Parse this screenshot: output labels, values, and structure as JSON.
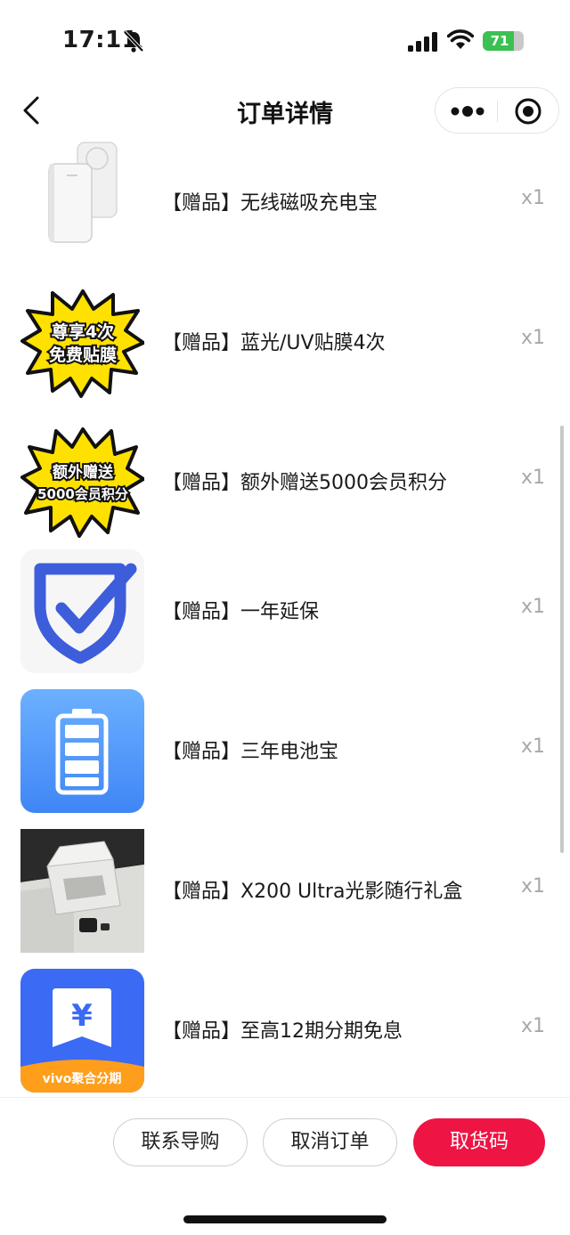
{
  "status_bar": {
    "time": "17:11",
    "battery_level": "71",
    "icons": [
      "bell-slash-icon",
      "signal-icon",
      "wifi-icon",
      "battery-icon"
    ]
  },
  "nav": {
    "title": "订单详情",
    "icons": [
      "chevron-left-icon",
      "more-dots-icon",
      "target-circle-icon"
    ]
  },
  "gifts": [
    {
      "name": "【赠品】无线磁吸充电宝",
      "qty": "x1",
      "thumb": "power-bank-image"
    },
    {
      "name": "【赠品】蓝光/UV贴膜4次",
      "qty": "x1",
      "thumb": "starburst-badge",
      "badge_lines": [
        "尊享4次",
        "免费贴膜"
      ]
    },
    {
      "name": "【赠品】额外赠送5000会员积分",
      "qty": "x1",
      "thumb": "starburst-badge",
      "badge_lines": [
        "额外赠送",
        "5000会员积分"
      ]
    },
    {
      "name": "【赠品】一年延保",
      "qty": "x1",
      "thumb": "shield-check-icon"
    },
    {
      "name": "【赠品】三年电池宝",
      "qty": "x1",
      "thumb": "battery-app-icon"
    },
    {
      "name": "【赠品】X200 Ultra光影随行礼盒",
      "qty": "x1",
      "thumb": "gift-box-photo"
    },
    {
      "name": "【赠品】至高12期分期免息",
      "qty": "x1",
      "thumb": "yuan-bookmark-icon",
      "badge_text": "vivo聚合分期"
    }
  ],
  "actions": {
    "contact": "联系导购",
    "cancel": "取消订单",
    "pickup": "取货码"
  },
  "colors": {
    "accent": "#ee1444",
    "badge_yellow": "#ffe100",
    "shield_blue": "#3d5ddb",
    "battery_blue": "#4b8ff8",
    "installment_blue": "#3b6af5",
    "installment_orange": "#ff9e1b"
  }
}
